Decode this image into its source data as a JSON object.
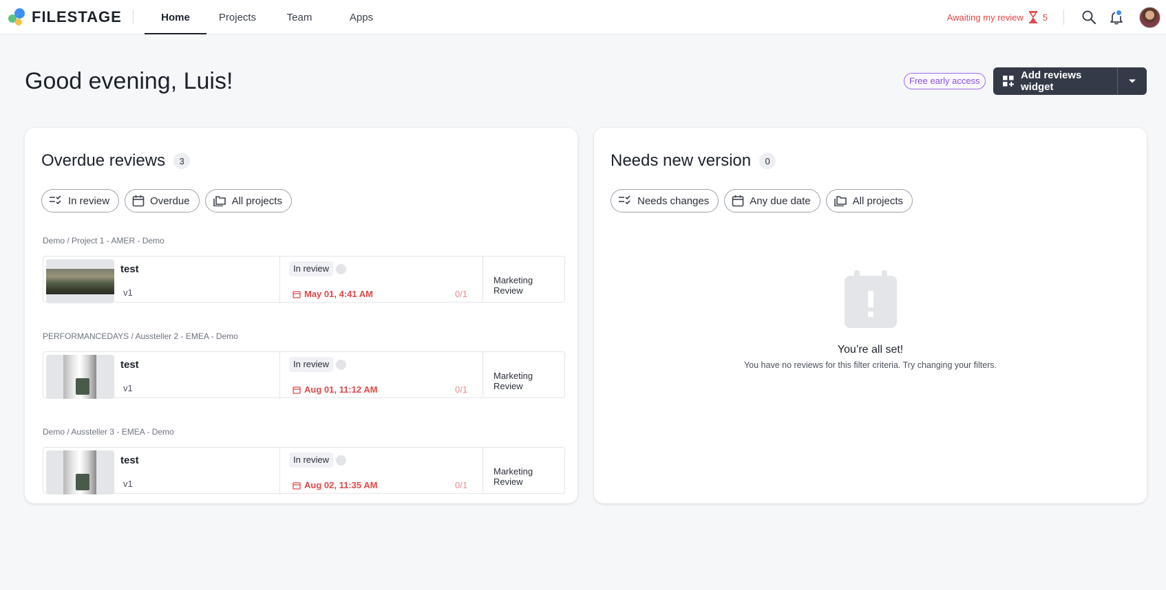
{
  "brand": {
    "name": "FILESTAGE"
  },
  "nav": {
    "items": [
      {
        "label": "Home"
      },
      {
        "label": "Projects"
      },
      {
        "label": "Team"
      },
      {
        "label": "Apps"
      }
    ]
  },
  "header": {
    "awaiting_label": "Awaiting my review",
    "awaiting_count": "5"
  },
  "greeting": "Good evening, Luis!",
  "early_access": "Free early access",
  "widget_button": "Add reviews widget",
  "overdue": {
    "title": "Overdue reviews",
    "count": "3",
    "filters": [
      {
        "label": "In review",
        "icon": "checklist-icon"
      },
      {
        "label": "Overdue",
        "icon": "calendar-icon"
      },
      {
        "label": "All projects",
        "icon": "folders-icon"
      }
    ],
    "groups": [
      {
        "project": "Demo / Project 1 - AMER - Demo",
        "file": "test",
        "version": "v1",
        "status": "In review",
        "due": "May 01, 4:41 AM",
        "ratio": "0/1",
        "workflow": "Marketing Review",
        "thumb": "landscape"
      },
      {
        "project": "PERFORMANCEDAYS / Aussteller 2 - EMEA - Demo",
        "file": "test",
        "version": "v1",
        "status": "In review",
        "due": "Aug 01, 11:12 AM",
        "ratio": "0/1",
        "workflow": "Marketing Review",
        "thumb": "frame"
      },
      {
        "project": "Demo / Aussteller 3 - EMEA - Demo",
        "file": "test",
        "version": "v1",
        "status": "In review",
        "due": "Aug 02, 11:35 AM",
        "ratio": "0/1",
        "workflow": "Marketing Review",
        "thumb": "frame"
      }
    ]
  },
  "needs_version": {
    "title": "Needs new version",
    "count": "0",
    "filters": [
      {
        "label": "Needs changes",
        "icon": "checklist-icon"
      },
      {
        "label": "Any due date",
        "icon": "calendar-icon"
      },
      {
        "label": "All projects",
        "icon": "folders-icon"
      }
    ],
    "empty_title": "You’re all set!",
    "empty_subtitle": "You have no reviews for this filter criteria. Try changing your filters."
  },
  "colors": {
    "accent_dark": "#343a47",
    "overdue_red": "#e04848",
    "early_access_purple": "#8a4de6",
    "notification_blue": "#3d8ff5"
  }
}
